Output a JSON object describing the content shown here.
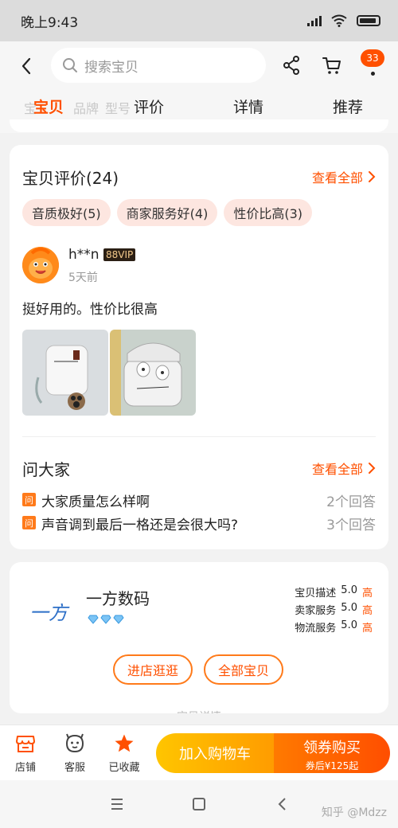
{
  "status_bar": {
    "time": "晚上9:43"
  },
  "header": {
    "search_placeholder": "搜索宝贝",
    "message_count": "33",
    "icons": [
      "back-icon",
      "search-icon",
      "share-icon",
      "cart-icon",
      "more-icon"
    ]
  },
  "tabs": {
    "partial": [
      "宝贝",
      "品牌",
      "型号"
    ],
    "items": [
      "评价",
      "详情",
      "推荐"
    ]
  },
  "reviews": {
    "title": "宝贝评价(24)",
    "view_all": "查看全部",
    "tags": [
      "音质极好(5)",
      "商家服务好(4)",
      "性价比高(3)"
    ],
    "review": {
      "user": "h**n",
      "vip": "88VIP",
      "time": "5天前",
      "text": "挺好用的。性价比很高"
    }
  },
  "qa": {
    "title": "问大家",
    "view_all": "查看全部",
    "icon_label": "问",
    "items": [
      {
        "question": "大家质量怎么样啊",
        "answers": "2个回答"
      },
      {
        "question": "声音调到最后一格还是会很大吗?",
        "answers": "3个回答"
      }
    ]
  },
  "shop": {
    "logo_text": "一方",
    "name": "一方数码",
    "ratings": [
      {
        "label": "宝贝描述",
        "score": "5.0",
        "level": "高"
      },
      {
        "label": "卖家服务",
        "score": "5.0",
        "level": "高"
      },
      {
        "label": "物流服务",
        "score": "5.0",
        "level": "高"
      }
    ],
    "enter_shop": "进店逛逛",
    "all_items": "全部宝贝",
    "next_section": "宝贝详情"
  },
  "action_bar": {
    "shop": "店铺",
    "service": "客服",
    "favorite": "已收藏",
    "add_to_cart": "加入购物车",
    "buy": "领券购买",
    "buy_sub": "券后¥125起"
  },
  "watermark": "知乎 @Mdzz",
  "colors": {
    "accent": "#ff5000",
    "chip_bg": "#fde6e0",
    "cart_btn": "#ffb300",
    "buy_btn": "#ff5a00"
  }
}
